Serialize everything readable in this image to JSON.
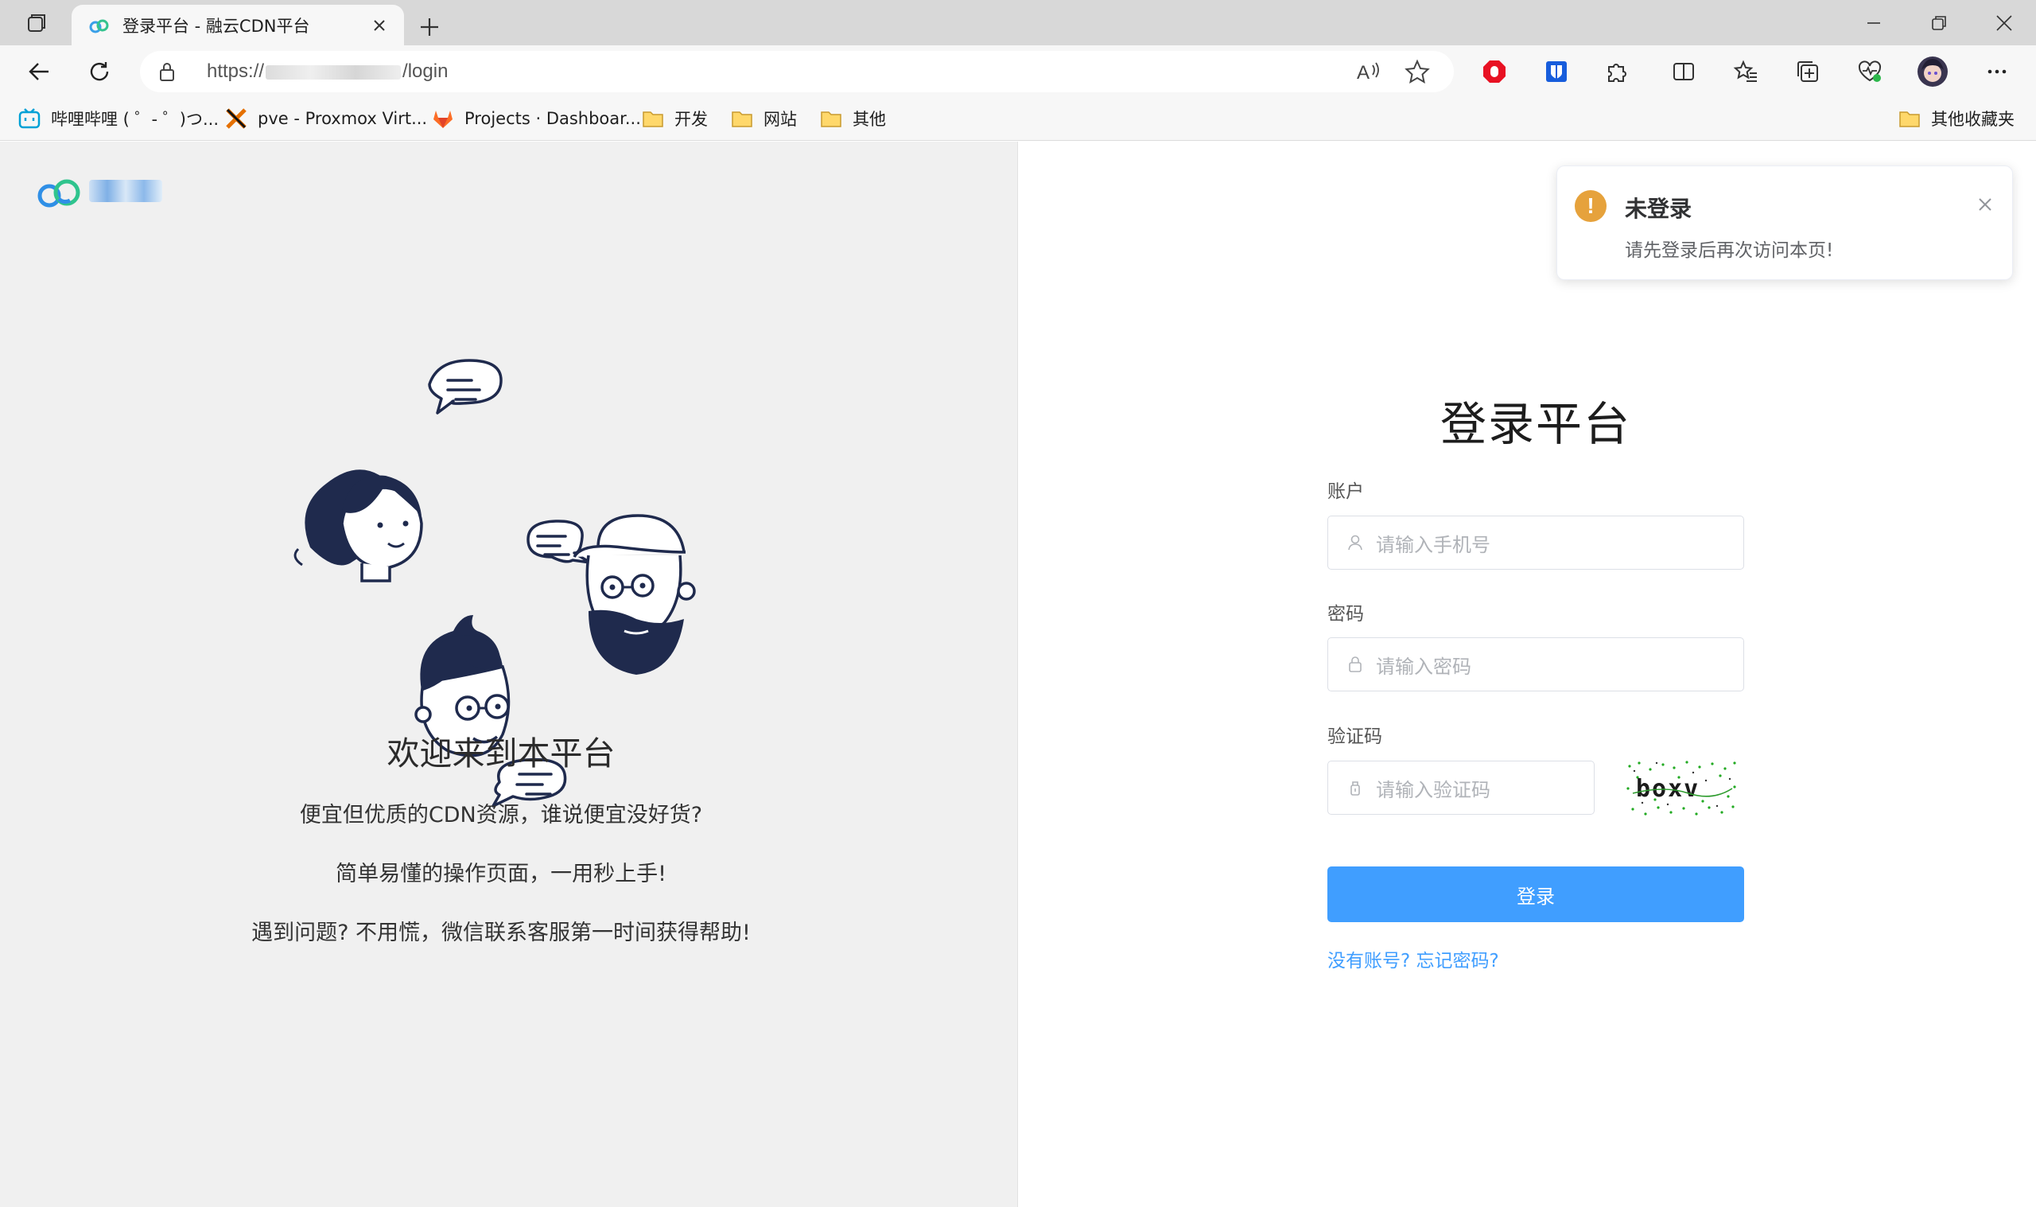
{
  "browser": {
    "tab_title": "登录平台 - 融云CDN平台",
    "url_prefix": "https://",
    "url_suffix": "/login"
  },
  "bookmarks": [
    {
      "label": "哔哩哔哩 ( ゜- ゜)つ...",
      "icon": "bilibili-icon"
    },
    {
      "label": "pve - Proxmox Virt...",
      "icon": "proxmox-icon"
    },
    {
      "label": "Projects · Dashboar...",
      "icon": "gitlab-icon"
    },
    {
      "label": "开发",
      "icon": "folder-icon"
    },
    {
      "label": "网站",
      "icon": "folder-icon"
    },
    {
      "label": "其他",
      "icon": "folder-icon"
    }
  ],
  "other_bookmarks": "其他收藏夹",
  "left_panel": {
    "welcome_title": "欢迎来到本平台",
    "lines": [
      "便宜但优质的CDN资源，谁说便宜没好货?",
      "简单易懂的操作页面，一用秒上手!",
      "遇到问题? 不用慌，微信联系客服第一时间获得帮助!"
    ]
  },
  "login": {
    "title": "登录平台",
    "account_label": "账户",
    "account_placeholder": "请输入手机号",
    "password_label": "密码",
    "password_placeholder": "请输入密码",
    "captcha_label": "验证码",
    "captcha_placeholder": "请输入验证码",
    "captcha_text": "boxv",
    "submit_label": "登录",
    "links_text": "没有账号? 忘记密码?"
  },
  "notification": {
    "title": "未登录",
    "message": "请先登录后再次访问本页!",
    "icon_text": "!"
  },
  "colors": {
    "primary": "#409eff",
    "warning": "#e6a23c",
    "left_bg": "#f0f0f0"
  }
}
